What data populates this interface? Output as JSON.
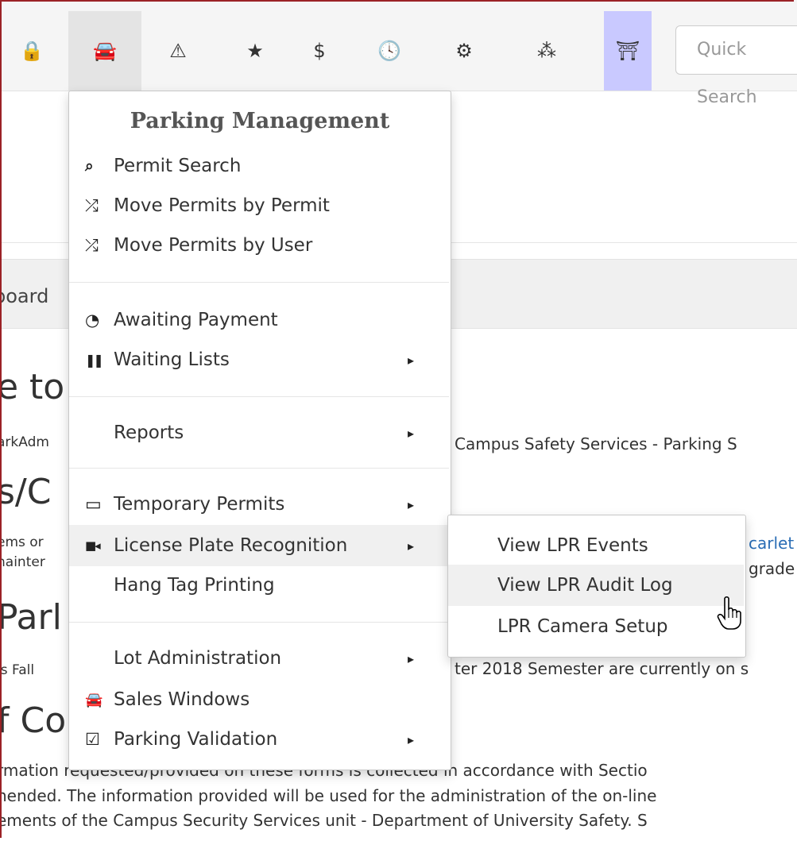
{
  "topnav": {
    "icons": [
      {
        "name": "lock-icon",
        "glyph": "🔒"
      },
      {
        "name": "car-icon",
        "glyph": "🚘"
      },
      {
        "name": "warning-icon",
        "glyph": "⚠"
      },
      {
        "name": "star-icon",
        "glyph": "★"
      },
      {
        "name": "dollar-icon",
        "glyph": "$"
      },
      {
        "name": "clock-icon",
        "glyph": "🕓"
      },
      {
        "name": "cogs-icon",
        "glyph": "⚙"
      },
      {
        "name": "cubes-icon",
        "glyph": "⁂"
      },
      {
        "name": "road-block-icon",
        "glyph": "⛩"
      }
    ],
    "quick_search_placeholder": "Quick Search",
    "active_color": "#e4e4e4",
    "highlight_color": "#c9c9ff"
  },
  "background": {
    "dashboard_text": "board",
    "heading1": "e to",
    "line1_left": "arkAdm",
    "line1_right": "Campus Safety Services - Parking S",
    "heading2": "s/C",
    "line2_left": "ems or",
    "line2_link": "carlet",
    "line3_left": "nainter",
    "line3_right": "grade",
    "heading3": "Parl",
    "line4_left": "is Fall",
    "line4_right": "ter 2018 Semester are currently on s",
    "heading4": "f Co",
    "para1": "rmation requested/provided on these forms is collected in accordance with Sectio",
    "para2": "hended. The information provided will be used for the administration of the on-line",
    "para3": "ements of the Campus Security Services unit - Department of University Safety. S"
  },
  "menu": {
    "header": "Parking Management",
    "items": [
      {
        "label": "Permit Search",
        "icon": "search-icon",
        "glyph": "🔍"
      },
      {
        "label": "Move Permits by Permit",
        "icon": "shuffle-icon",
        "glyph": "⤮"
      },
      {
        "label": "Move Permits by User",
        "icon": "shuffle-icon",
        "glyph": "⤮"
      },
      {
        "label": "Awaiting Payment",
        "icon": "clock-icon",
        "glyph": "◔"
      },
      {
        "label": "Waiting Lists",
        "icon": "pause-icon",
        "glyph": "❚❚"
      },
      {
        "label": "Reports",
        "icon": "",
        "glyph": ""
      },
      {
        "label": "Temporary Permits",
        "icon": "ticket-icon",
        "glyph": "▭"
      },
      {
        "label": "License Plate Recognition",
        "icon": "video-camera-icon",
        "glyph": "■◂"
      },
      {
        "label": "Hang Tag Printing",
        "icon": "",
        "glyph": ""
      },
      {
        "label": "Lot Administration",
        "icon": "",
        "glyph": ""
      },
      {
        "label": "Sales Windows",
        "icon": "car-icon",
        "glyph": "🚘"
      },
      {
        "label": "Parking Validation",
        "icon": "check-square-icon",
        "glyph": "☑"
      }
    ]
  },
  "submenu": {
    "items": [
      {
        "label": "View LPR Events"
      },
      {
        "label": "View LPR Audit Log"
      },
      {
        "label": "LPR Camera Setup"
      }
    ]
  }
}
